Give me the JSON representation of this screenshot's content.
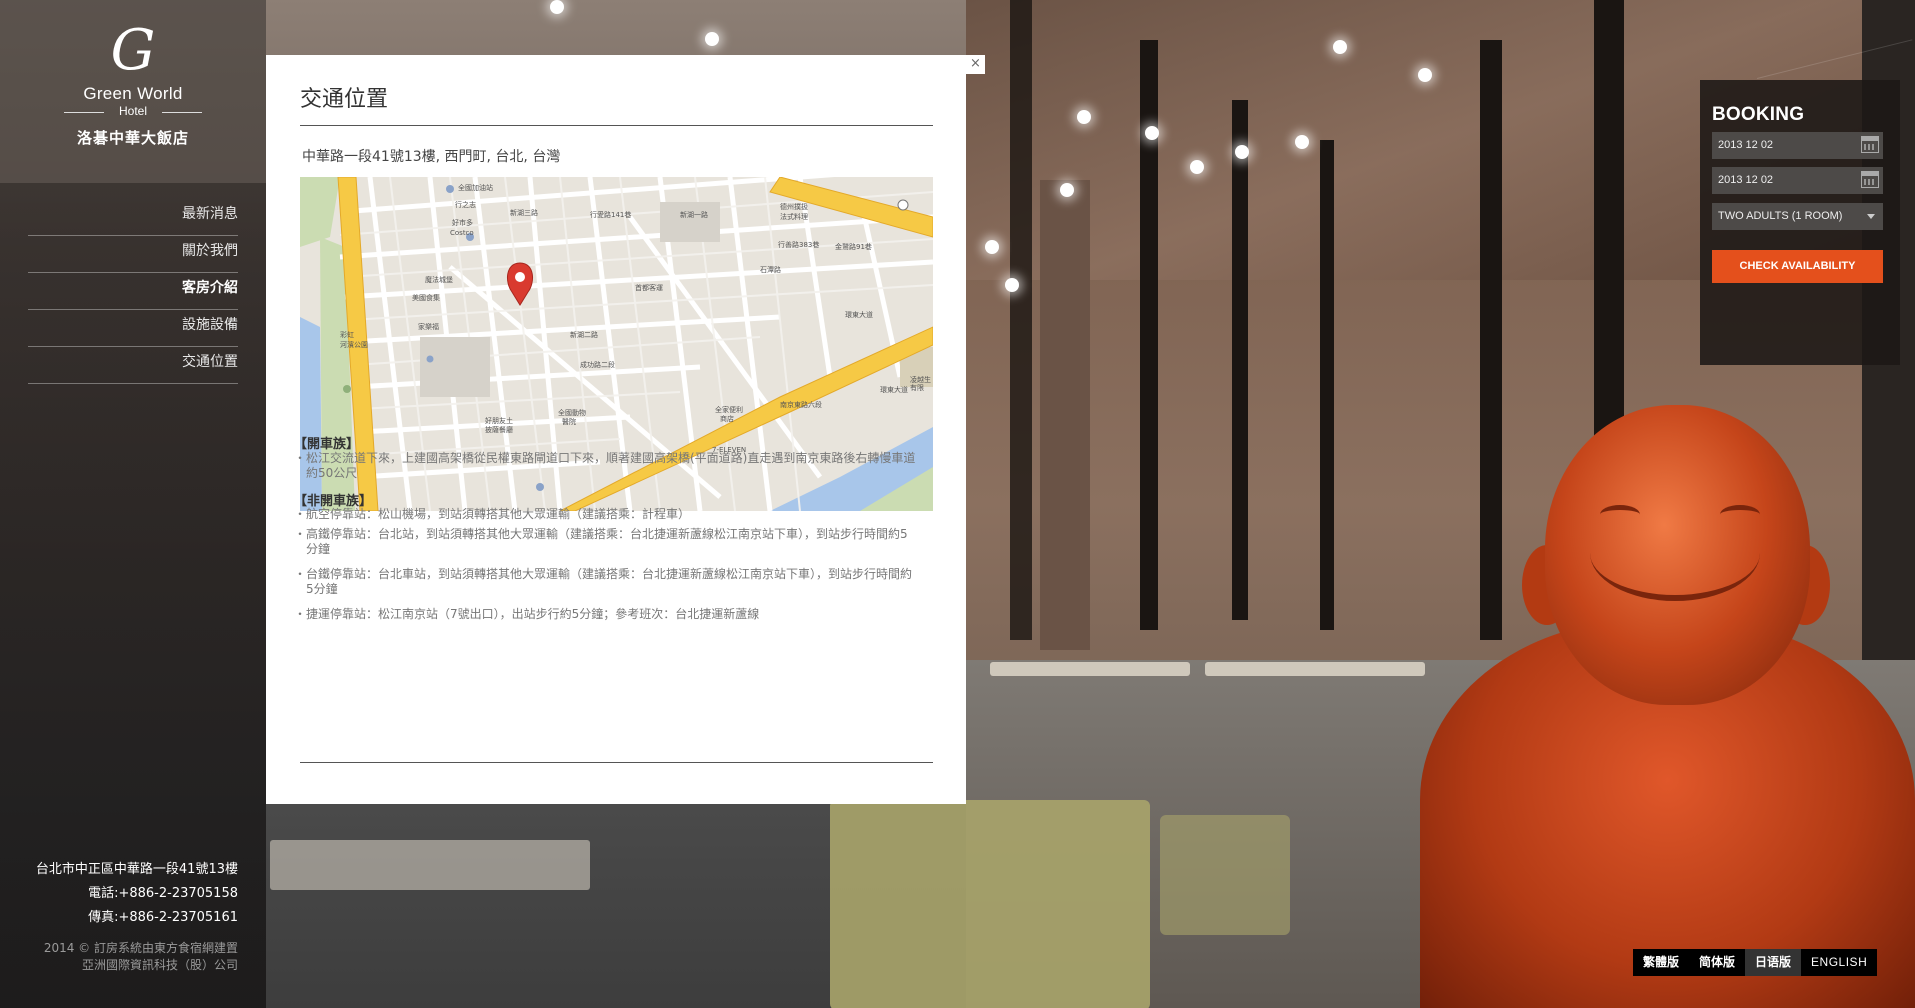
{
  "brand": {
    "logo_letter": "G",
    "name_en": "Green World",
    "sub_en": "Hotel",
    "name_cn": "洛碁中華大飯店"
  },
  "nav": {
    "items": [
      {
        "label": "最新消息"
      },
      {
        "label": "關於我們"
      },
      {
        "label": "客房介紹",
        "active": true
      },
      {
        "label": "設施設備"
      },
      {
        "label": "交通位置"
      }
    ]
  },
  "contact": {
    "address": "台北市中正區中華路一段41號13樓",
    "phone": "電話:+886-2-23705158",
    "fax": "傳真:+886-2-23705161"
  },
  "copyright": {
    "line1": "2014 © 訂房系統由東方食宿網建置",
    "line2": "亞洲國際資訊科技（股）公司"
  },
  "modal": {
    "close_label": "×",
    "title": "交通位置",
    "address": "中華路一段41號13樓, 西門町, 台北, 台灣",
    "map_labels": [
      "全國加油站",
      "行之志",
      "好市多",
      "Costco",
      "新湖三路",
      "行愛路141巷",
      "新湖一路",
      "德州撲扱",
      "法式料理",
      "行善路383巷",
      "金鷲路91巷",
      "石潭路",
      "魔法城堡",
      "美國食集",
      "首都客運",
      "新湖二路",
      "家樂福",
      "成功路二段",
      "全國動物",
      "醫院",
      "好朋友土",
      "披薩餐廳",
      "全家便利",
      "商店",
      "7-ELEVEN",
      "環東大道",
      "南京東路六段",
      "凌越生",
      "有限",
      "彩虹",
      "河濱公園",
      "環東大道"
    ],
    "driving": {
      "heading": "【開車族】",
      "items": [
        "松江交流道下來，上建國高架橋從民權東路閘道口下來，順著建國高架橋(平面道路)直走遇到南京東路後右轉慢車道約50公尺"
      ]
    },
    "transit": {
      "heading": "【非開車族】",
      "items": [
        "航空停靠站：松山機場，到站須轉搭其他大眾運輸（建議搭乘：計程車）",
        "高鐵停靠站：台北站，到站須轉搭其他大眾運輸（建議搭乘：台北捷運新蘆線松江南京站下車），到站步行時間約5分鐘",
        "台鐵停靠站：台北車站，到站須轉搭其他大眾運輸（建議搭乘：台北捷運新蘆線松江南京站下車），到站步行時間約5分鐘",
        "捷運停靠站：松江南京站（7號出口），出站步行約5分鐘；參考班次：台北捷運新蘆線"
      ]
    }
  },
  "booking": {
    "title": "BOOKING",
    "checkin": "2013 12 02",
    "checkout": "2013 12 02",
    "guests": "TWO ADULTS (1 ROOM)",
    "button": "CHECK AVAILABILITY",
    "accent_color": "#e4501c"
  },
  "languages": [
    {
      "label": "繁體版"
    },
    {
      "label": "简体版"
    },
    {
      "label": "日语版"
    },
    {
      "label": "ENGLISH"
    }
  ]
}
